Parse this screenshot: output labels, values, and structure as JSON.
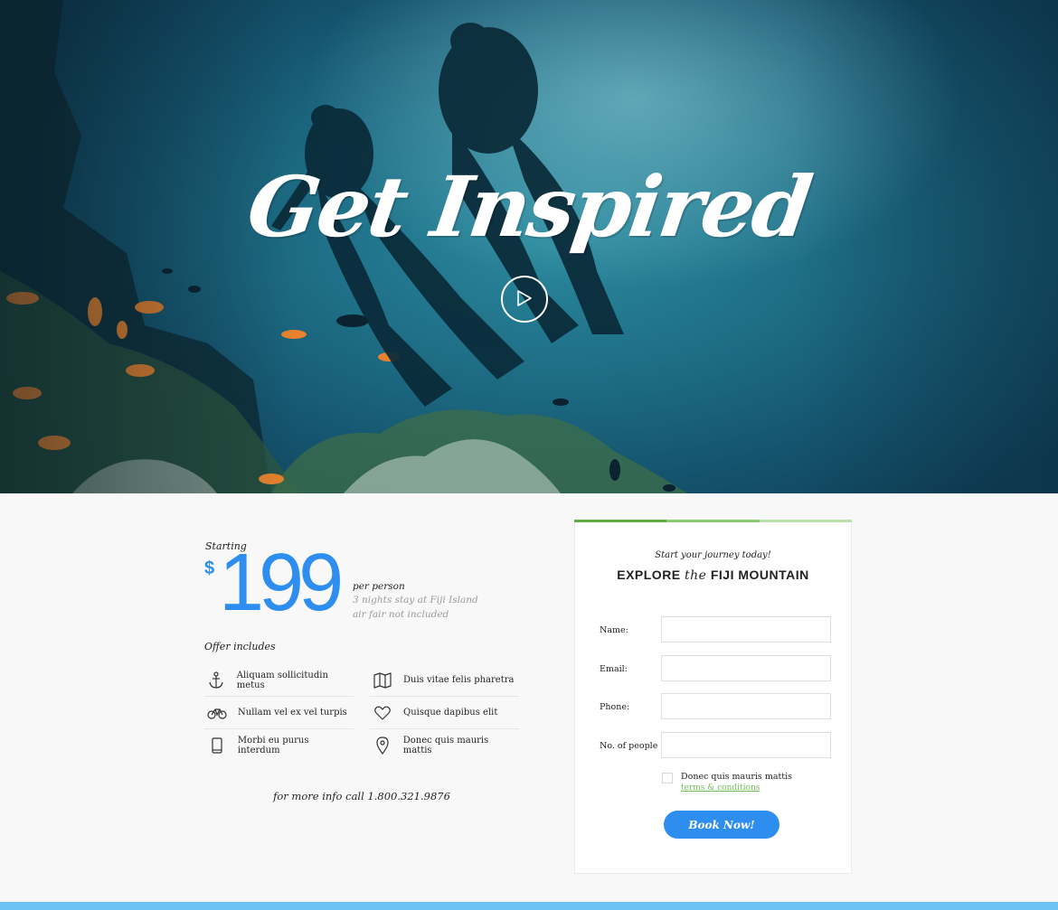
{
  "hero": {
    "title": "Get Inspired",
    "play_icon": "play-icon"
  },
  "pricing": {
    "starting_label": "Starting",
    "currency": "$",
    "amount": "199",
    "per_person": "per person",
    "detail_1": "3 nights stay at Fiji Island",
    "detail_2": "air fair not included",
    "accent_color": "#2d8ef0"
  },
  "offer": {
    "title": "Offer includes",
    "items": [
      {
        "icon": "anchor-icon",
        "label": "Aliquam sollicitudin metus"
      },
      {
        "icon": "map-icon",
        "label": "Duis vitae felis pharetra"
      },
      {
        "icon": "bicycle-icon",
        "label": "Nullam vel ex vel turpis"
      },
      {
        "icon": "heart-icon",
        "label": "Quisque dapibus elit"
      },
      {
        "icon": "phone-icon",
        "label": "Morbi eu purus interdum"
      },
      {
        "icon": "location-pin-icon",
        "label": "Donec quis mauris mattis"
      }
    ]
  },
  "more_info": "for more info call 1.800.321.9876",
  "form": {
    "tagline": "Start your journey today!",
    "heading_pre": "EXPLORE",
    "heading_the": "the",
    "heading_post": "FIJI MOUNTAIN",
    "fields": [
      {
        "label": "Name:",
        "value": ""
      },
      {
        "label": "Email:",
        "value": ""
      },
      {
        "label": "Phone:",
        "value": ""
      },
      {
        "label": "No. of people",
        "value": ""
      }
    ],
    "checkbox_text": "Donec quis mauris mattis",
    "terms_link": "terms & conditions",
    "submit_label": "Book Now!",
    "top_bar_colors": [
      "#5fae44",
      "#8ccb72",
      "#b8e0a8"
    ]
  },
  "colors": {
    "accent": "#2d8ef0",
    "link_green": "#6fbb56",
    "bottom_bar": "#6cc2f2"
  }
}
